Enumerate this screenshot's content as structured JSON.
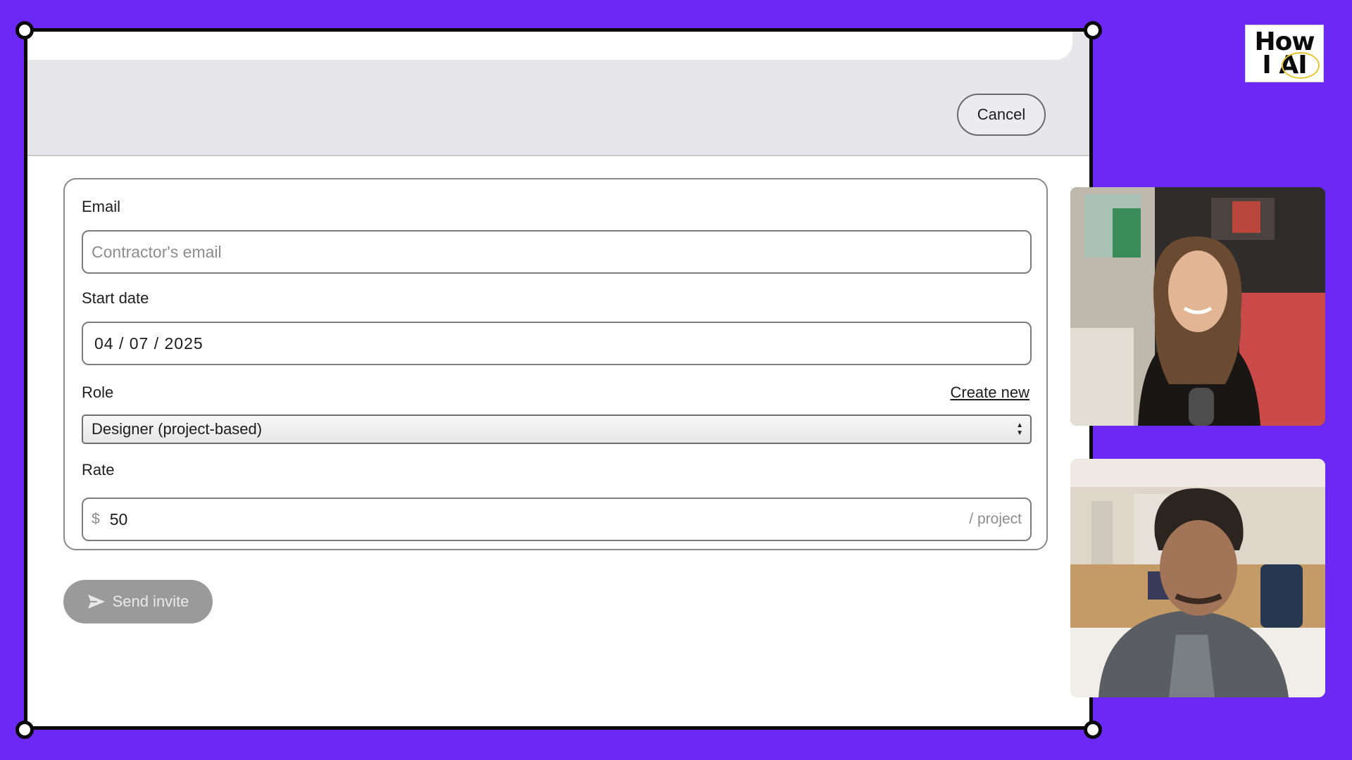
{
  "header": {
    "cancel_label": "Cancel"
  },
  "form": {
    "email": {
      "label": "Email",
      "placeholder": "Contractor's email",
      "value": ""
    },
    "start_date": {
      "label": "Start date",
      "value": "04 / 07 / 2025"
    },
    "role": {
      "label": "Role",
      "create_new_label": "Create new",
      "selected": "Designer (project-based)"
    },
    "rate": {
      "label": "Rate",
      "prefix": "$",
      "value": "50",
      "suffix": "/ project"
    }
  },
  "actions": {
    "send_invite_label": "Send invite"
  },
  "logo": {
    "line1": "How",
    "line2": "I AI"
  },
  "colors": {
    "background": "#6c28f5",
    "topbar": "#e7e7ea",
    "send_button": "#9a9a9a",
    "logo_ring": "#e5c432"
  },
  "icons": {
    "send": "send-icon",
    "select_arrows": "select-arrows-icon"
  }
}
